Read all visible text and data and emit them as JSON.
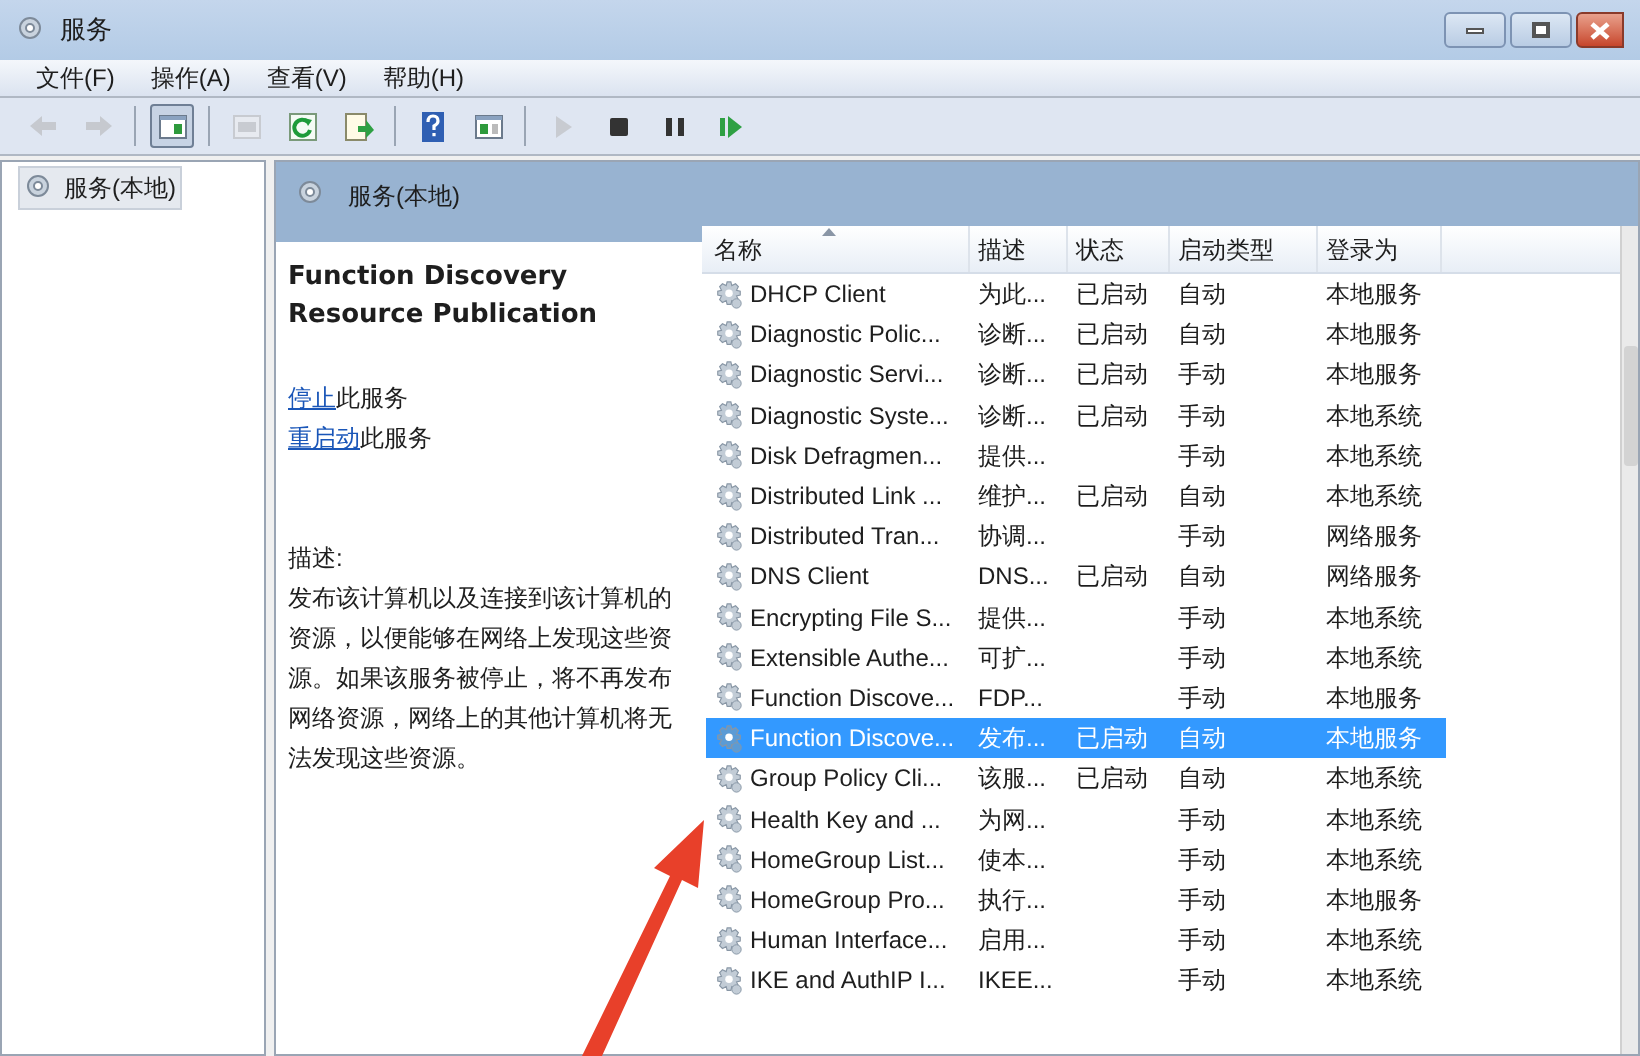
{
  "window": {
    "title": "服务"
  },
  "menu": [
    {
      "label": "文件(F)"
    },
    {
      "label": "操作(A)"
    },
    {
      "label": "查看(V)"
    },
    {
      "label": "帮助(H)"
    }
  ],
  "toolbar": [
    {
      "kind": "back",
      "disabled": true,
      "pressed": false
    },
    {
      "kind": "forward",
      "disabled": true,
      "pressed": false
    },
    {
      "kind": "separator"
    },
    {
      "kind": "tree",
      "disabled": false,
      "pressed": true
    },
    {
      "kind": "separator"
    },
    {
      "kind": "properties",
      "disabled": true,
      "pressed": false
    },
    {
      "kind": "refresh",
      "disabled": false,
      "pressed": false
    },
    {
      "kind": "export",
      "disabled": false,
      "pressed": false
    },
    {
      "kind": "separator"
    },
    {
      "kind": "help",
      "disabled": false,
      "pressed": false
    },
    {
      "kind": "panel",
      "disabled": false,
      "pressed": false
    },
    {
      "kind": "separator"
    },
    {
      "kind": "play",
      "disabled": true,
      "pressed": false
    },
    {
      "kind": "stop",
      "disabled": false,
      "pressed": false
    },
    {
      "kind": "pause",
      "disabled": false,
      "pressed": false
    },
    {
      "kind": "resume",
      "disabled": false,
      "pressed": false
    }
  ],
  "tree": {
    "items": [
      {
        "label": "服务(本地)",
        "selected": true
      }
    ]
  },
  "pane": {
    "title": "服务(本地)"
  },
  "details": {
    "service_name": "Function Discovery Resource Publication",
    "actions": [
      {
        "link": "停止",
        "text": "此服务"
      },
      {
        "link": "重启动",
        "text": "此服务"
      }
    ],
    "description_label": "描述:",
    "description": "发布该计算机以及连接到该计算机的资源，以便能够在网络上发现这些资源。如果该服务被停止，将不再发布网络资源，网络上的其他计算机将无法发现这些资源。"
  },
  "table": {
    "columns": [
      {
        "label": "名称",
        "sorted": true
      },
      {
        "label": "描述",
        "sorted": false
      },
      {
        "label": "状态",
        "sorted": false
      },
      {
        "label": "启动类型",
        "sorted": false
      },
      {
        "label": "登录为",
        "sorted": false
      }
    ],
    "rows": [
      {
        "cells": [
          "DHCP Client",
          "为此...",
          "已启动",
          "自动",
          "本地服务"
        ],
        "selected": false
      },
      {
        "cells": [
          "Diagnostic Polic...",
          "诊断...",
          "已启动",
          "自动",
          "本地服务"
        ],
        "selected": false
      },
      {
        "cells": [
          "Diagnostic Servi...",
          "诊断...",
          "已启动",
          "手动",
          "本地服务"
        ],
        "selected": false
      },
      {
        "cells": [
          "Diagnostic Syste...",
          "诊断...",
          "已启动",
          "手动",
          "本地系统"
        ],
        "selected": false
      },
      {
        "cells": [
          "Disk Defragmen...",
          "提供...",
          "",
          "手动",
          "本地系统"
        ],
        "selected": false
      },
      {
        "cells": [
          "Distributed Link ...",
          "维护...",
          "已启动",
          "自动",
          "本地系统"
        ],
        "selected": false
      },
      {
        "cells": [
          "Distributed Tran...",
          "协调...",
          "",
          "手动",
          "网络服务"
        ],
        "selected": false
      },
      {
        "cells": [
          "DNS Client",
          "DNS...",
          "已启动",
          "自动",
          "网络服务"
        ],
        "selected": false
      },
      {
        "cells": [
          "Encrypting File S...",
          "提供...",
          "",
          "手动",
          "本地系统"
        ],
        "selected": false
      },
      {
        "cells": [
          "Extensible Authe...",
          "可扩...",
          "",
          "手动",
          "本地系统"
        ],
        "selected": false
      },
      {
        "cells": [
          "Function Discove...",
          "FDP...",
          "",
          "手动",
          "本地服务"
        ],
        "selected": false
      },
      {
        "cells": [
          "Function Discove...",
          "发布...",
          "已启动",
          "自动",
          "本地服务"
        ],
        "selected": true
      },
      {
        "cells": [
          "Group Policy Cli...",
          "该服...",
          "已启动",
          "自动",
          "本地系统"
        ],
        "selected": false
      },
      {
        "cells": [
          "Health Key and ...",
          "为网...",
          "",
          "手动",
          "本地系统"
        ],
        "selected": false
      },
      {
        "cells": [
          "HomeGroup List...",
          "使本...",
          "",
          "手动",
          "本地系统"
        ],
        "selected": false
      },
      {
        "cells": [
          "HomeGroup Pro...",
          "执行...",
          "",
          "手动",
          "本地服务"
        ],
        "selected": false
      },
      {
        "cells": [
          "Human Interface...",
          "启用...",
          "",
          "手动",
          "本地系统"
        ],
        "selected": false
      },
      {
        "cells": [
          "IKE and AuthIP I...",
          "IKEE...",
          "",
          "手动",
          "本地系统"
        ],
        "selected": false
      }
    ]
  }
}
